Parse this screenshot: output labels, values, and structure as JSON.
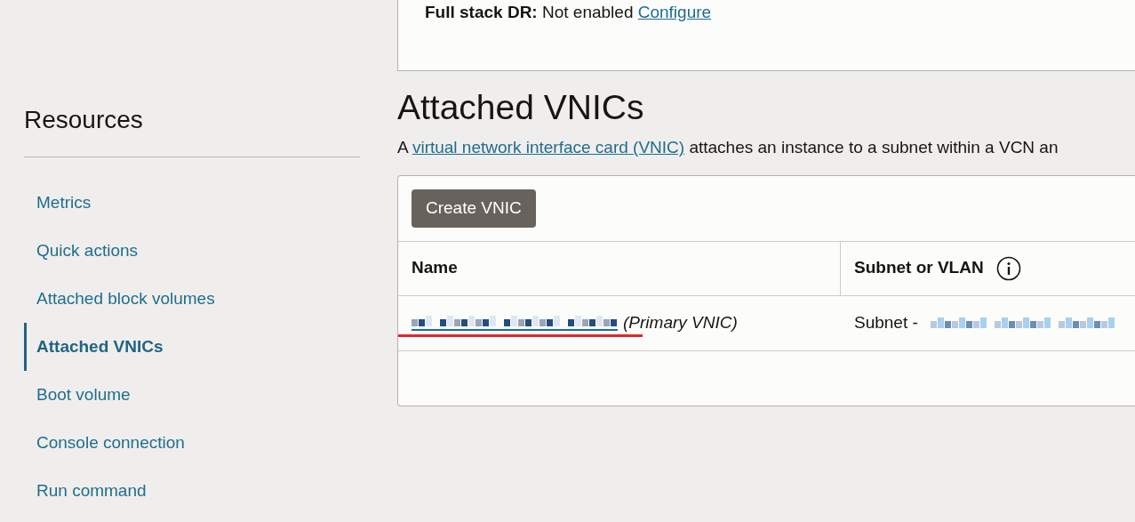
{
  "top_card": {
    "label": "Full stack DR:",
    "value": "Not enabled",
    "link": "Configure"
  },
  "sidebar": {
    "title": "Resources",
    "items": [
      {
        "label": "Metrics",
        "selected": false
      },
      {
        "label": "Quick actions",
        "selected": false
      },
      {
        "label": "Attached block volumes",
        "selected": false
      },
      {
        "label": "Attached VNICs",
        "selected": true
      },
      {
        "label": "Boot volume",
        "selected": false
      },
      {
        "label": "Console connection",
        "selected": false
      },
      {
        "label": "Run command",
        "selected": false
      }
    ]
  },
  "section": {
    "title": "Attached VNICs",
    "description_prefix": "A",
    "description_link": "virtual network interface card (VNIC)",
    "description_suffix": "attaches an instance to a subnet within a VCN an"
  },
  "create_button": "Create VNIC",
  "table": {
    "columns": [
      {
        "label": "Name",
        "info": false
      },
      {
        "label": "Subnet or VLAN",
        "info": true
      }
    ],
    "rows": [
      {
        "name_suffix": "(Primary VNIC)",
        "subnet_prefix": "Subnet -"
      }
    ]
  }
}
